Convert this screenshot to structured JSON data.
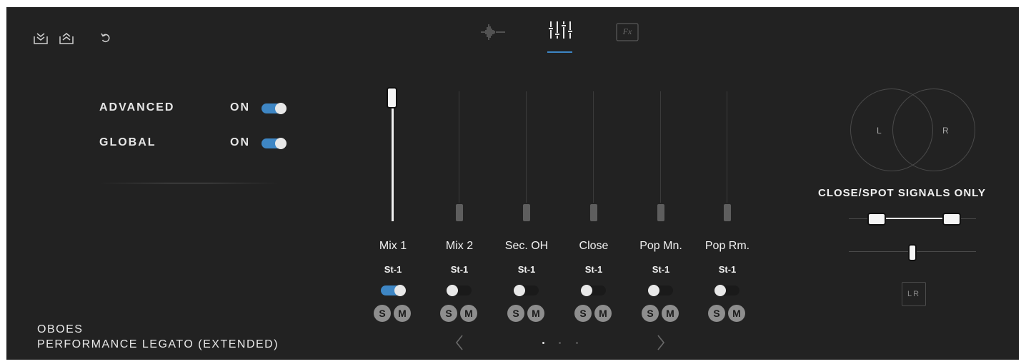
{
  "toolbar": {
    "icons": [
      "download-preset-icon",
      "upload-preset-icon",
      "undo-icon"
    ]
  },
  "tabs": [
    {
      "name": "waveform-tab",
      "icon": "waveform-icon"
    },
    {
      "name": "mixer-tab",
      "icon": "mixer-icon",
      "active": true
    },
    {
      "name": "fx-tab",
      "icon": "fx-icon",
      "label": "Fx"
    }
  ],
  "settings": {
    "advanced": {
      "label": "ADVANCED",
      "value": "ON",
      "enabled": true
    },
    "global": {
      "label": "GLOBAL",
      "value": "ON",
      "enabled": true
    }
  },
  "channels": [
    {
      "name": "Mix 1",
      "output": "St-1",
      "enabled": true,
      "level": 1.0,
      "solo": "S",
      "mute": "M"
    },
    {
      "name": "Mix 2",
      "output": "St-1",
      "enabled": false,
      "level": 0.0,
      "solo": "S",
      "mute": "M"
    },
    {
      "name": "Sec. OH",
      "output": "St-1",
      "enabled": false,
      "level": 0.0,
      "solo": "S",
      "mute": "M"
    },
    {
      "name": "Close",
      "output": "St-1",
      "enabled": false,
      "level": 0.0,
      "solo": "S",
      "mute": "M"
    },
    {
      "name": "Pop Mn.",
      "output": "St-1",
      "enabled": false,
      "level": 0.0,
      "solo": "S",
      "mute": "M"
    },
    {
      "name": "Pop Rm.",
      "output": "St-1",
      "enabled": false,
      "level": 0.0,
      "solo": "S",
      "mute": "M"
    }
  ],
  "instrument": {
    "name": "OBOES",
    "articulation": "PERFORMANCE LEGATO (EXTENDED)"
  },
  "pager": {
    "pages": 3,
    "current": 1
  },
  "stereo": {
    "left_label": "L",
    "right_label": "R",
    "signals_label": "CLOSE/SPOT SIGNALS ONLY",
    "width_range": [
      0.15,
      0.85
    ],
    "pan": 0.5,
    "lr_button": "LR"
  },
  "colors": {
    "background": "#222222",
    "accent": "#3e86c4",
    "button_gray": "#8e8e8e"
  }
}
